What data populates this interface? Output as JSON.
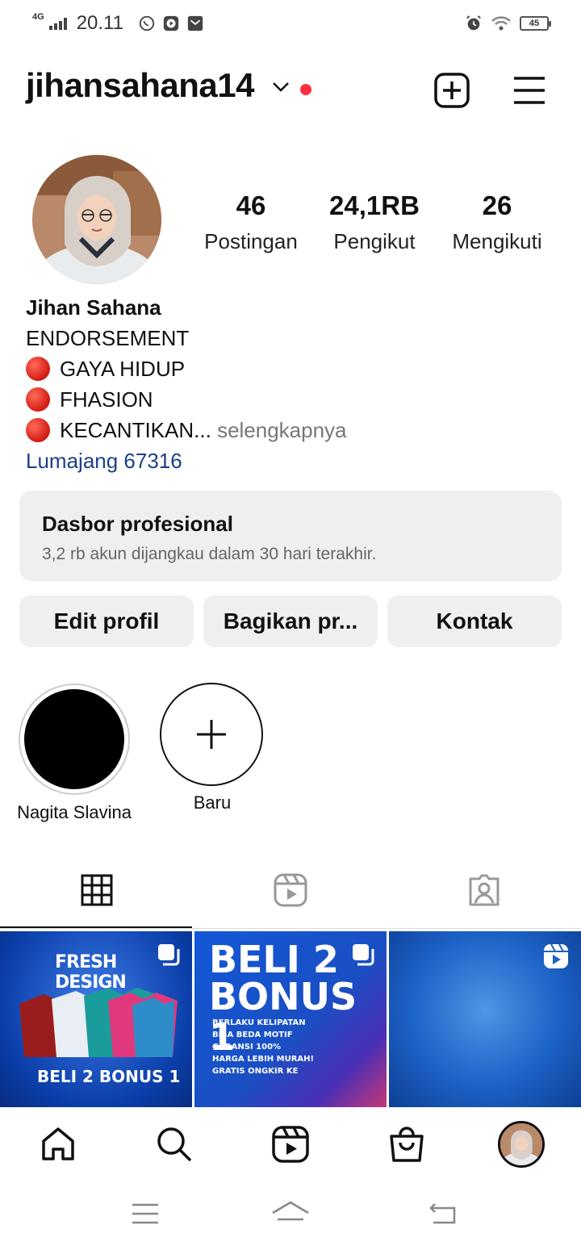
{
  "status_bar": {
    "network": "4G",
    "time": "20.11",
    "battery": "45"
  },
  "header": {
    "username": "jihansahana14"
  },
  "profile": {
    "stats": [
      {
        "value": "46",
        "label": "Postingan"
      },
      {
        "value": "24,1RB",
        "label": "Pengikut"
      },
      {
        "value": "26",
        "label": "Mengikuti"
      }
    ],
    "name": "Jihan Sahana",
    "bio_line1": "ENDORSEMENT",
    "bio_line2": "GAYA HIDUP",
    "bio_line3": "FHASION",
    "bio_line4": "KECANTIKAN...",
    "more": "selengkapnya",
    "location": "Lumajang 67316"
  },
  "dashboard": {
    "title": "Dasbor profesional",
    "subtitle": "3,2 rb akun dijangkau dalam 30 hari terakhir."
  },
  "buttons": {
    "edit": "Edit profil",
    "share": "Bagikan pr...",
    "contact": "Kontak"
  },
  "highlights": [
    {
      "label": "Nagita Slavina"
    },
    {
      "label": "Baru"
    }
  ],
  "posts": {
    "post1_brand": "FRESH DESIGN",
    "post1_promo": "BELI 2 BONUS 1",
    "post2_headline1": "BELI 2",
    "post2_headline2": "BONUS 1",
    "post2_points": [
      "BERLAKU KELIPATAN",
      "BISA BEDA MOTIF",
      "GARANSI 100%",
      "HARGA LEBIH MURAH!",
      "GRATIS ONGKIR KE"
    ]
  },
  "colors": {
    "accent_red": "#ff3040",
    "link_blue": "#1d3f8a",
    "button_bg": "#efefef"
  }
}
